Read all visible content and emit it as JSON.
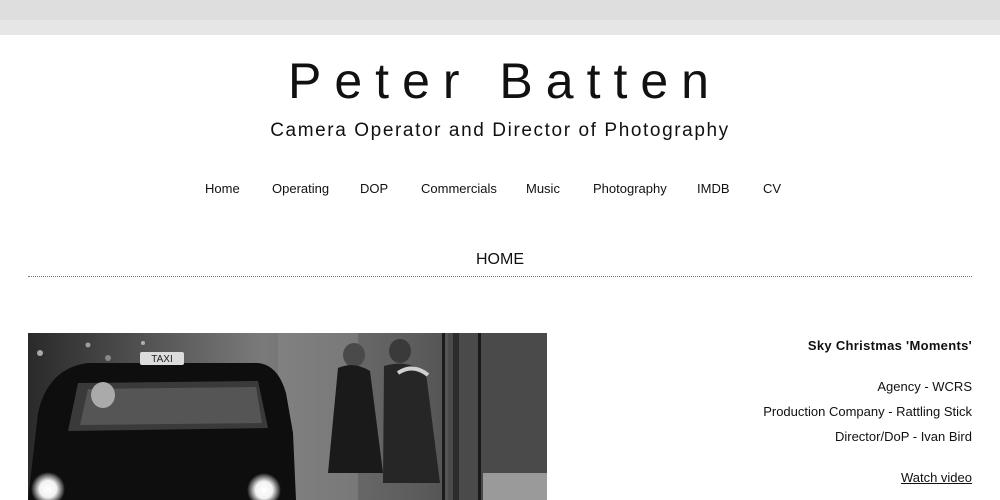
{
  "header": {
    "title": "Peter Batten",
    "subtitle": "Camera Operator and Director of Photography"
  },
  "nav": {
    "items": [
      "Home",
      "Operating",
      "DOP",
      "Commercials",
      "Music",
      "Photography",
      "IMDB",
      "CV"
    ]
  },
  "page": {
    "heading": "HOME"
  },
  "hero": {
    "taxi_sign": "TAXI"
  },
  "project": {
    "title": "Sky Christmas 'Moments'",
    "agency": "Agency - WCRS",
    "production": "Production Company - Rattling Stick",
    "director": "Director/DoP - Ivan Bird",
    "watch_label": "Watch video"
  }
}
